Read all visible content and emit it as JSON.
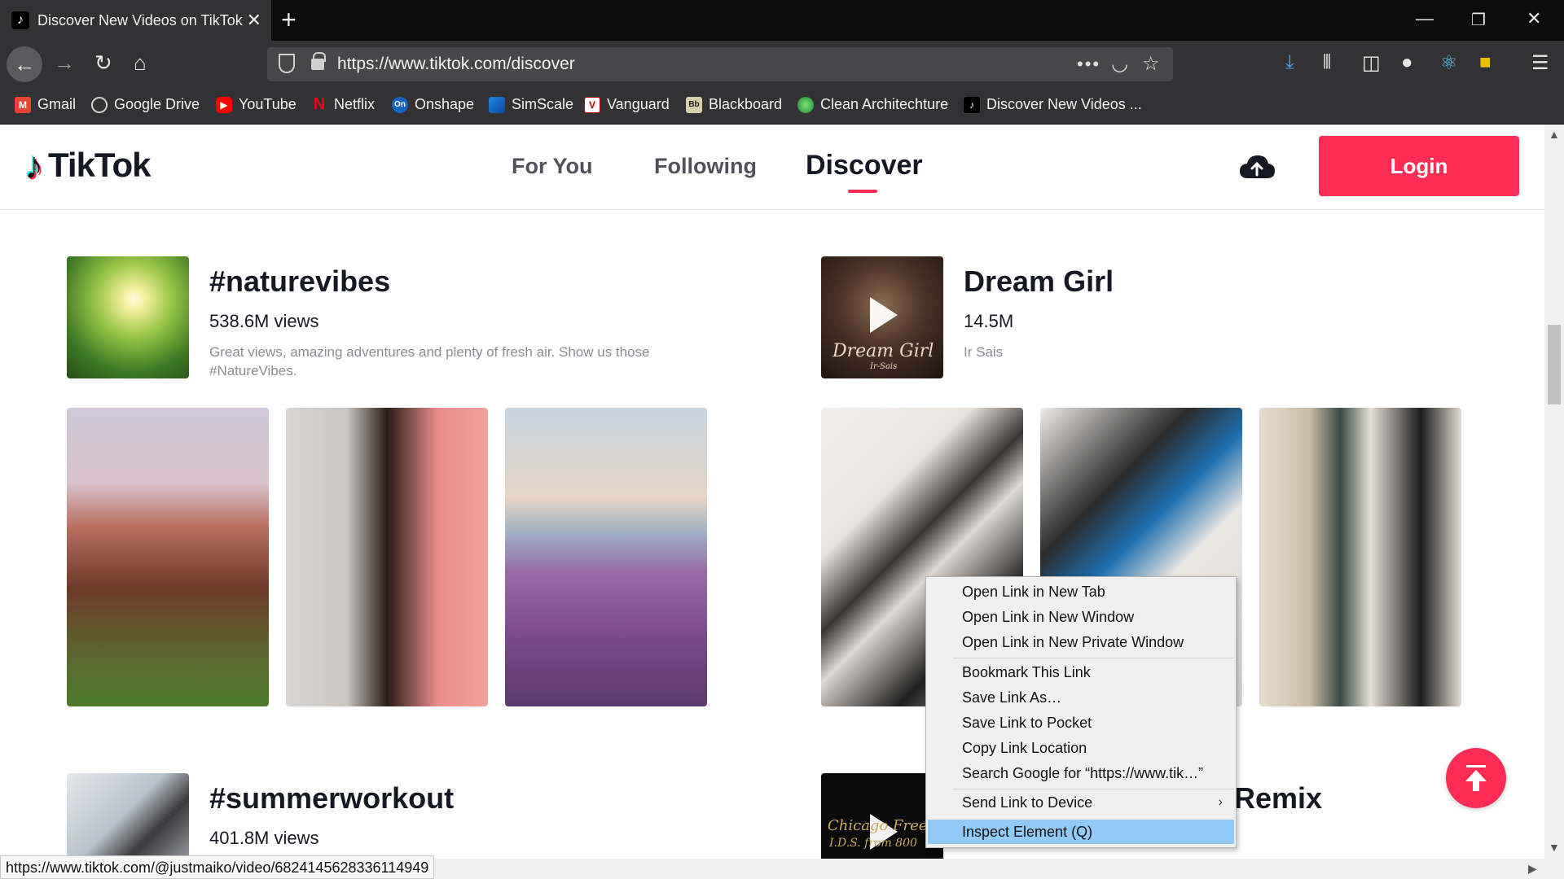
{
  "browser": {
    "tab_title": "Discover New Videos on TikTok",
    "url": "https://www.tiktok.com/discover",
    "bookmarks": [
      {
        "label": "Gmail",
        "icon": "gmail-icon",
        "color": "#ea4335"
      },
      {
        "label": "Google Drive",
        "icon": "globe-icon",
        "color": "#cfcfcf"
      },
      {
        "label": "YouTube",
        "icon": "youtube-icon",
        "color": "#ff0000"
      },
      {
        "label": "Netflix",
        "icon": "netflix-icon",
        "color": "#e50914"
      },
      {
        "label": "Onshape",
        "icon": "onshape-icon",
        "color": "#1565c0"
      },
      {
        "label": "SimScale",
        "icon": "simscale-icon",
        "color": "#1e88e5"
      },
      {
        "label": "Vanguard",
        "icon": "vanguard-icon",
        "color": "#c00"
      },
      {
        "label": "Blackboard",
        "icon": "blackboard-icon",
        "color": "#333"
      },
      {
        "label": "Clean Architechture",
        "icon": "green-orb-icon",
        "color": "#2e9e3a"
      },
      {
        "label": "Discover New Videos ...",
        "icon": "tiktok-icon",
        "color": "#000"
      }
    ]
  },
  "tiktok": {
    "logo_text": "TikTok",
    "nav": [
      "For You",
      "Following",
      "Discover"
    ],
    "login_label": "Login",
    "accent": "#fe2c55",
    "sections": [
      {
        "title": "#naturevibes",
        "views": "538.6M views",
        "desc": "Great views, amazing adventures and plenty of fresh air. Show us those #NatureVibes."
      },
      {
        "title": "Dream Girl",
        "views": "14.5M",
        "desc": "Ir Sais",
        "thumb_text": "Dream Girl",
        "thumb_sub": "Ir-Sais"
      },
      {
        "title": "#summerworkout",
        "views": "401.8M views"
      },
      {
        "title": "Remix",
        "thumb_text": "Chicago Freestyle",
        "thumb_sub": "I.D.S. from 800"
      }
    ]
  },
  "status_url": "https://www.tiktok.com/@justmaiko/video/6824145628336114949",
  "context_menu": [
    "Open Link in New Tab",
    "Open Link in New Window",
    "Open Link in New Private Window",
    "Bookmark This Link",
    "Save Link As…",
    "Save Link to Pocket",
    "Copy Link Location",
    "Search Google for “https://www.tik…”",
    "Send Link to Device",
    "Inspect Element (Q)"
  ]
}
